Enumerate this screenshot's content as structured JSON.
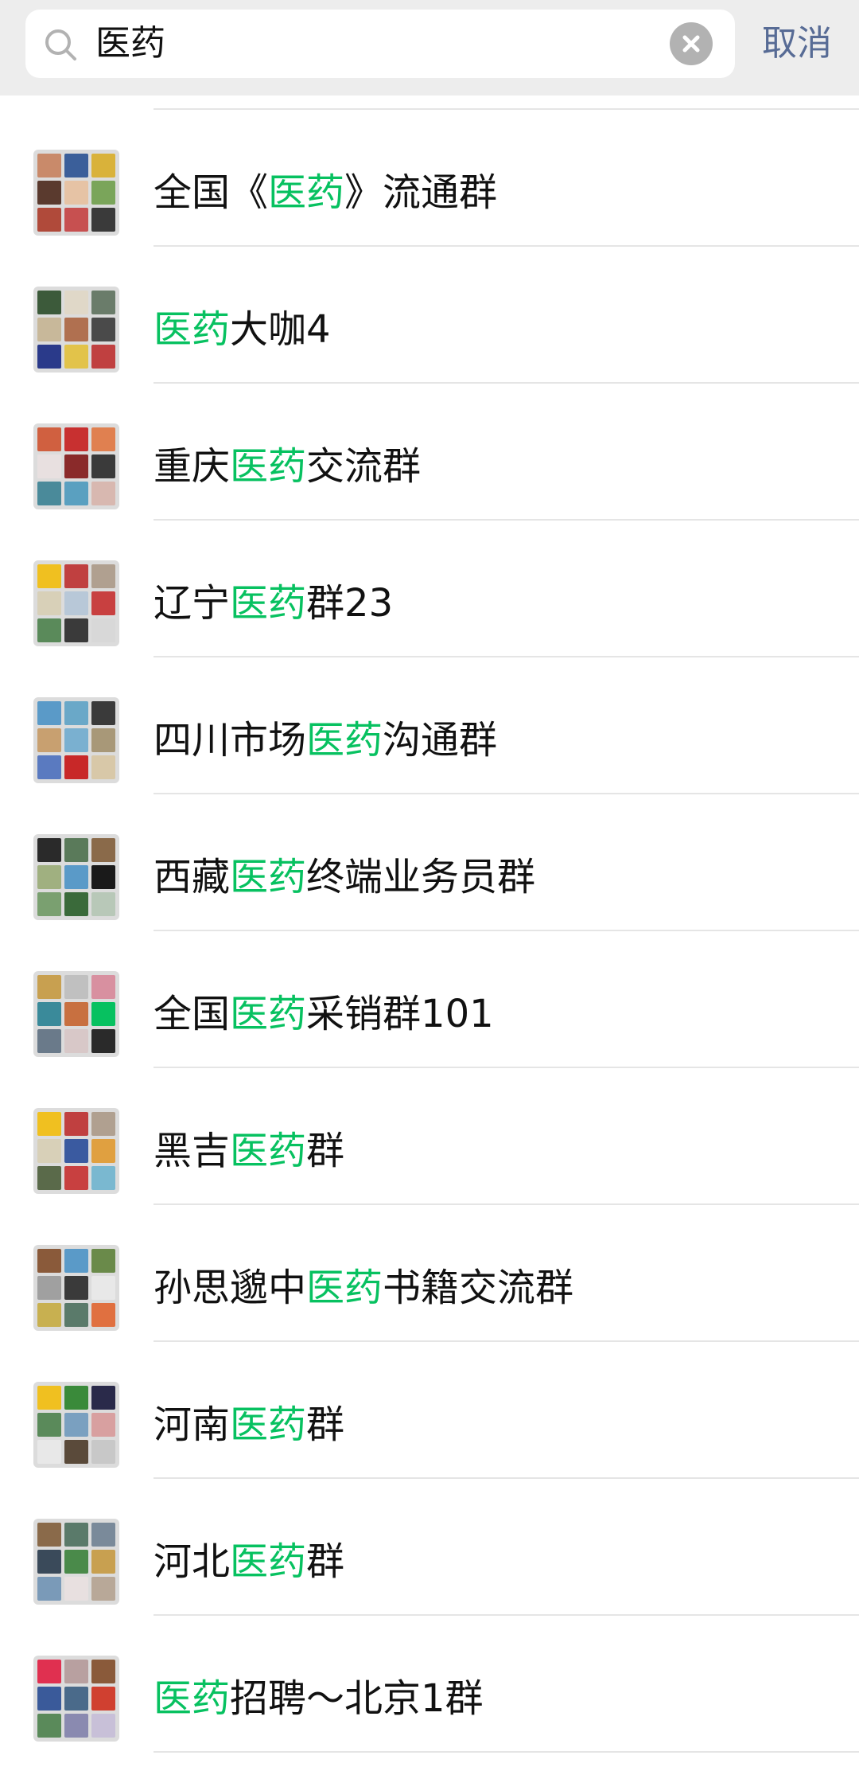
{
  "search": {
    "query": "医药",
    "cancel_label": "取消"
  },
  "results": [
    {
      "before": "全国《",
      "match": "医药",
      "after": "》流通群",
      "colors": [
        "#c98a6a",
        "#3b5f9a",
        "#d9b23a",
        "#5a3a2e",
        "#e6c3a5",
        "#7aa55a",
        "#b04a3a",
        "#c75050",
        "#3a3a3a"
      ]
    },
    {
      "before": "",
      "match": "医药",
      "after": "大咖4",
      "colors": [
        "#3c5a3a",
        "#e0d8c8",
        "#6a7c6a",
        "#c8b89a",
        "#b07050",
        "#4a4a4a",
        "#2a3a8a",
        "#e2c34a",
        "#c04040"
      ]
    },
    {
      "before": "重庆",
      "match": "医药",
      "after": "交流群",
      "colors": [
        "#d06040",
        "#c83030",
        "#e08050",
        "#e8e0e0",
        "#8a2a2a",
        "#3a3a3a",
        "#4a8a9a",
        "#5aa0c0",
        "#d8b8b0"
      ]
    },
    {
      "before": "辽宁",
      "match": "医药",
      "after": "群23",
      "colors": [
        "#f0c020",
        "#c04040",
        "#b0a090",
        "#d8d0b8",
        "#b8c8d8",
        "#c84040",
        "#5a8a5a",
        "#3a3a3a",
        "#d8d8d8"
      ]
    },
    {
      "before": "四川市场",
      "match": "医药",
      "after": "沟通群",
      "colors": [
        "#5a9ac8",
        "#6aa8c8",
        "#3a3a3a",
        "#c8a070",
        "#7ab0d0",
        "#a89878",
        "#5a7ac0",
        "#c82828",
        "#d8c8a8"
      ]
    },
    {
      "before": "西藏",
      "match": "医药",
      "after": "终端业务员群",
      "colors": [
        "#2a2a2a",
        "#5a7a5a",
        "#8a6a4a",
        "#a0b080",
        "#5a9ac8",
        "#1a1a1a",
        "#7aa070",
        "#3a6a3a",
        "#b8c8b8"
      ]
    },
    {
      "before": "全国",
      "match": "医药",
      "after": "采销群101",
      "colors": [
        "#c8a050",
        "#c0c0c0",
        "#d890a0",
        "#3a8a9a",
        "#c87040",
        "#07c160",
        "#6a7a8a",
        "#d8c8c8",
        "#2a2a2a"
      ]
    },
    {
      "before": "黑吉",
      "match": "医药",
      "after": "群",
      "colors": [
        "#f0c020",
        "#c04040",
        "#b0a090",
        "#d8d0b8",
        "#3a5aa0",
        "#e0a040",
        "#5a6a4a",
        "#c84040",
        "#7ab8d0"
      ]
    },
    {
      "before": "孙思邈中",
      "match": "医药",
      "after": "书籍交流群",
      "colors": [
        "#8a5a3a",
        "#5a9ac8",
        "#6a8a4a",
        "#a0a0a0",
        "#3a3a3a",
        "#e8e8e8",
        "#c8b050",
        "#5a7a6a",
        "#e07040"
      ]
    },
    {
      "before": "河南",
      "match": "医药",
      "after": "群",
      "colors": [
        "#f0c020",
        "#3a8a3a",
        "#2a2a4a",
        "#5a8a5a",
        "#7aa0c0",
        "#d8a0a0",
        "#e8e8e8",
        "#5a4a3a",
        "#c8c8c8"
      ]
    },
    {
      "before": "河北",
      "match": "医药",
      "after": "群",
      "colors": [
        "#8a6a4a",
        "#5a7a6a",
        "#7a8a9a",
        "#3a4a5a",
        "#4a8a4a",
        "#c8a050",
        "#7a9ab8",
        "#e8e0e0",
        "#b8a898"
      ]
    },
    {
      "before": "",
      "match": "医药",
      "after": "招聘～北京1群",
      "colors": [
        "#e03050",
        "#b8a0a0",
        "#8a5a3a",
        "#3a5a9a",
        "#4a6a8a",
        "#d04030",
        "#5a8a5a",
        "#8a8ab0",
        "#c8c0d8"
      ]
    }
  ],
  "colors": {
    "highlight": "#07c160",
    "link": "#576b95",
    "header_bg": "#ededed"
  }
}
